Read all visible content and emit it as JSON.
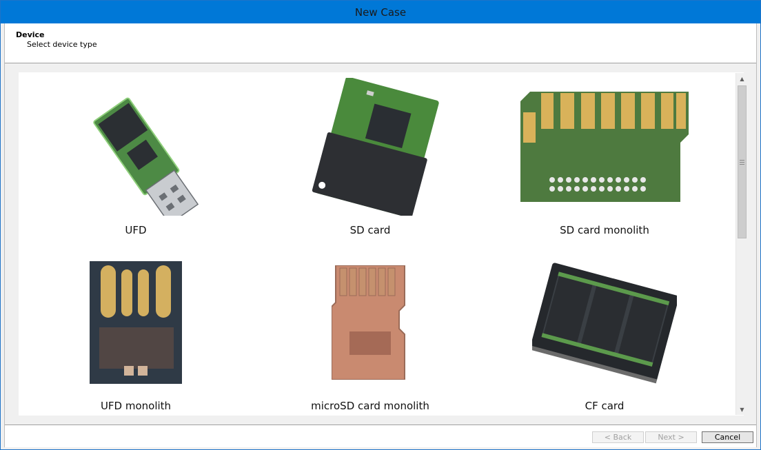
{
  "window": {
    "title": "New Case"
  },
  "header": {
    "title": "Device",
    "subtitle": "Select device type"
  },
  "devices": [
    {
      "label": "UFD",
      "icon": "usb-flash-drive-board-image"
    },
    {
      "label": "SD card",
      "icon": "sd-card-board-image"
    },
    {
      "label": "SD card monolith",
      "icon": "sd-card-monolith-image"
    },
    {
      "label": "UFD monolith",
      "icon": "ufd-monolith-image"
    },
    {
      "label": "microSD card monolith",
      "icon": "microsd-monolith-image"
    },
    {
      "label": "CF card",
      "icon": "cf-card-image"
    }
  ],
  "footer": {
    "back_label": "< Back",
    "next_label": "Next >",
    "cancel_label": "Cancel"
  },
  "colors": {
    "titlebar": "#0078d7",
    "pcb_green": "#3c7a3a",
    "copper": "#c98a70",
    "gold": "#d9b25a"
  }
}
